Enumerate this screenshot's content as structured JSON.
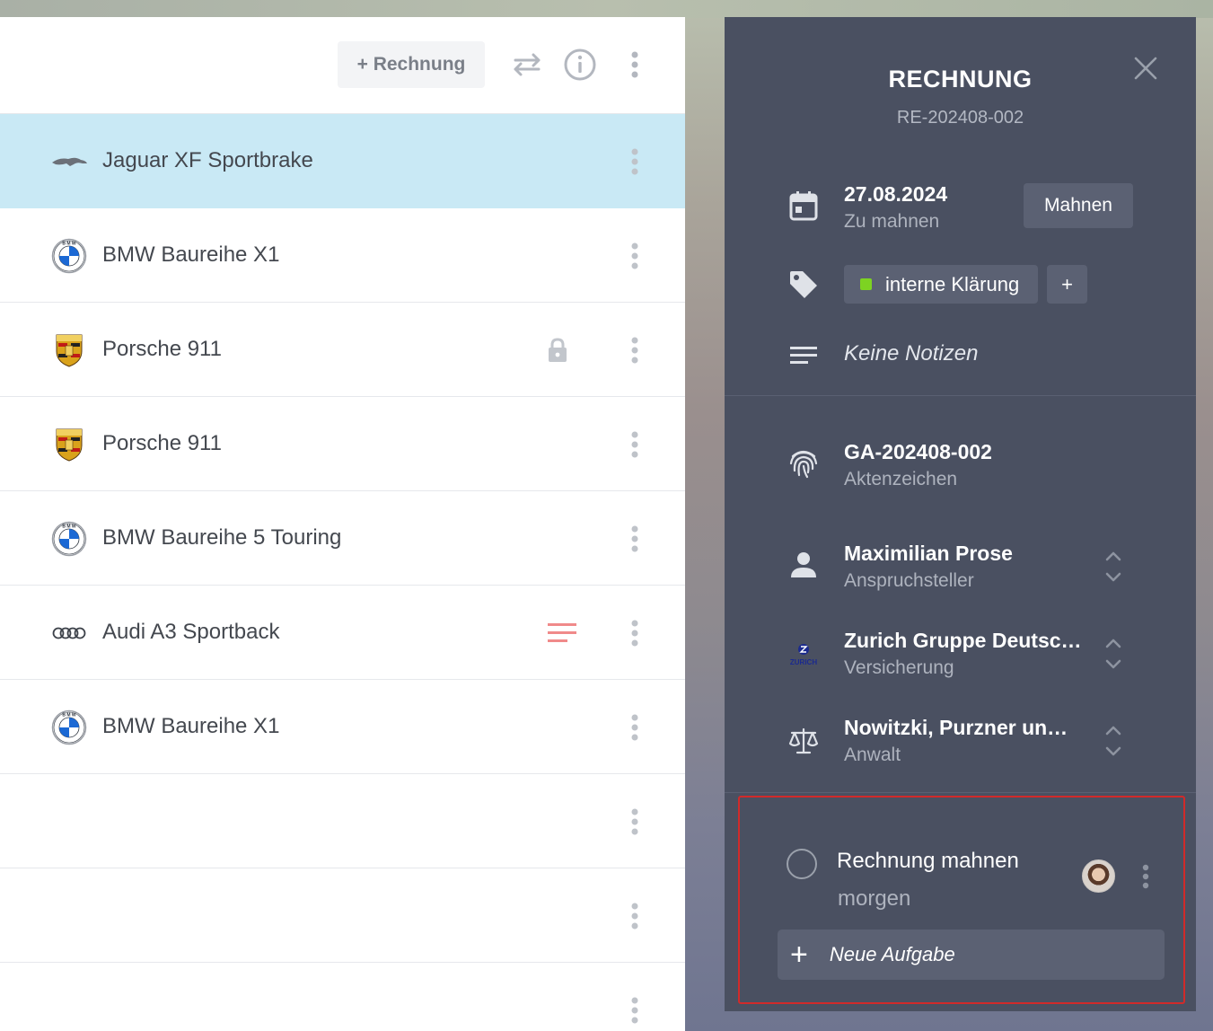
{
  "toolbar": {
    "add_invoice_label": "+ Rechnung",
    "icons": [
      "swap-icon",
      "info-icon",
      "more-vertical-icon"
    ]
  },
  "list": {
    "rows": [
      {
        "label": "Jaguar XF Sportbrake",
        "logo": "jaguar-logo",
        "selected": true,
        "status": ""
      },
      {
        "label": "BMW Baureihe X1",
        "logo": "bmw-logo",
        "selected": false,
        "status": ""
      },
      {
        "label": "Porsche 911",
        "logo": "porsche-logo",
        "selected": false,
        "status": "lock-icon"
      },
      {
        "label": "Porsche 911",
        "logo": "porsche-logo",
        "selected": false,
        "status": ""
      },
      {
        "label": "BMW Baureihe 5 Touring",
        "logo": "bmw-logo",
        "selected": false,
        "status": ""
      },
      {
        "label": "Audi A3 Sportback",
        "logo": "audi-logo",
        "selected": false,
        "status": "notes-icon"
      },
      {
        "label": "BMW Baureihe X1",
        "logo": "bmw-logo",
        "selected": false,
        "status": ""
      },
      {
        "label": "",
        "logo": "",
        "selected": false,
        "status": ""
      },
      {
        "label": "",
        "logo": "",
        "selected": false,
        "status": ""
      },
      {
        "label": "",
        "logo": "",
        "selected": false,
        "status": ""
      }
    ]
  },
  "detail": {
    "title": "RECHNUNG",
    "number": "RE-202408-002",
    "due_date": "27.08.2024",
    "due_status": "Zu mahnen",
    "mahnen_label": "Mahnen",
    "tag_label": "interne Klärung",
    "tag_color": "#7dd322",
    "tag_add_label": "+",
    "notes": "Keine Notizen",
    "file_number": "GA-202408-002",
    "file_number_label": "Aktenzeichen",
    "claimant": "Maximilian Prose",
    "claimant_label": "Anspruchsteller",
    "insurance": "Zurich Gruppe Deutsc…",
    "insurance_label": "Versicherung",
    "insurance_logo_text": "ZURICH",
    "lawyer": "Nowitzki, Purzner un…",
    "lawyer_label": "Anwalt"
  },
  "tasks": {
    "items": [
      {
        "title": "Rechnung mahnen",
        "due": "morgen",
        "done": false
      }
    ],
    "new_task_label": "Neue Aufgabe",
    "new_task_plus": "+"
  }
}
